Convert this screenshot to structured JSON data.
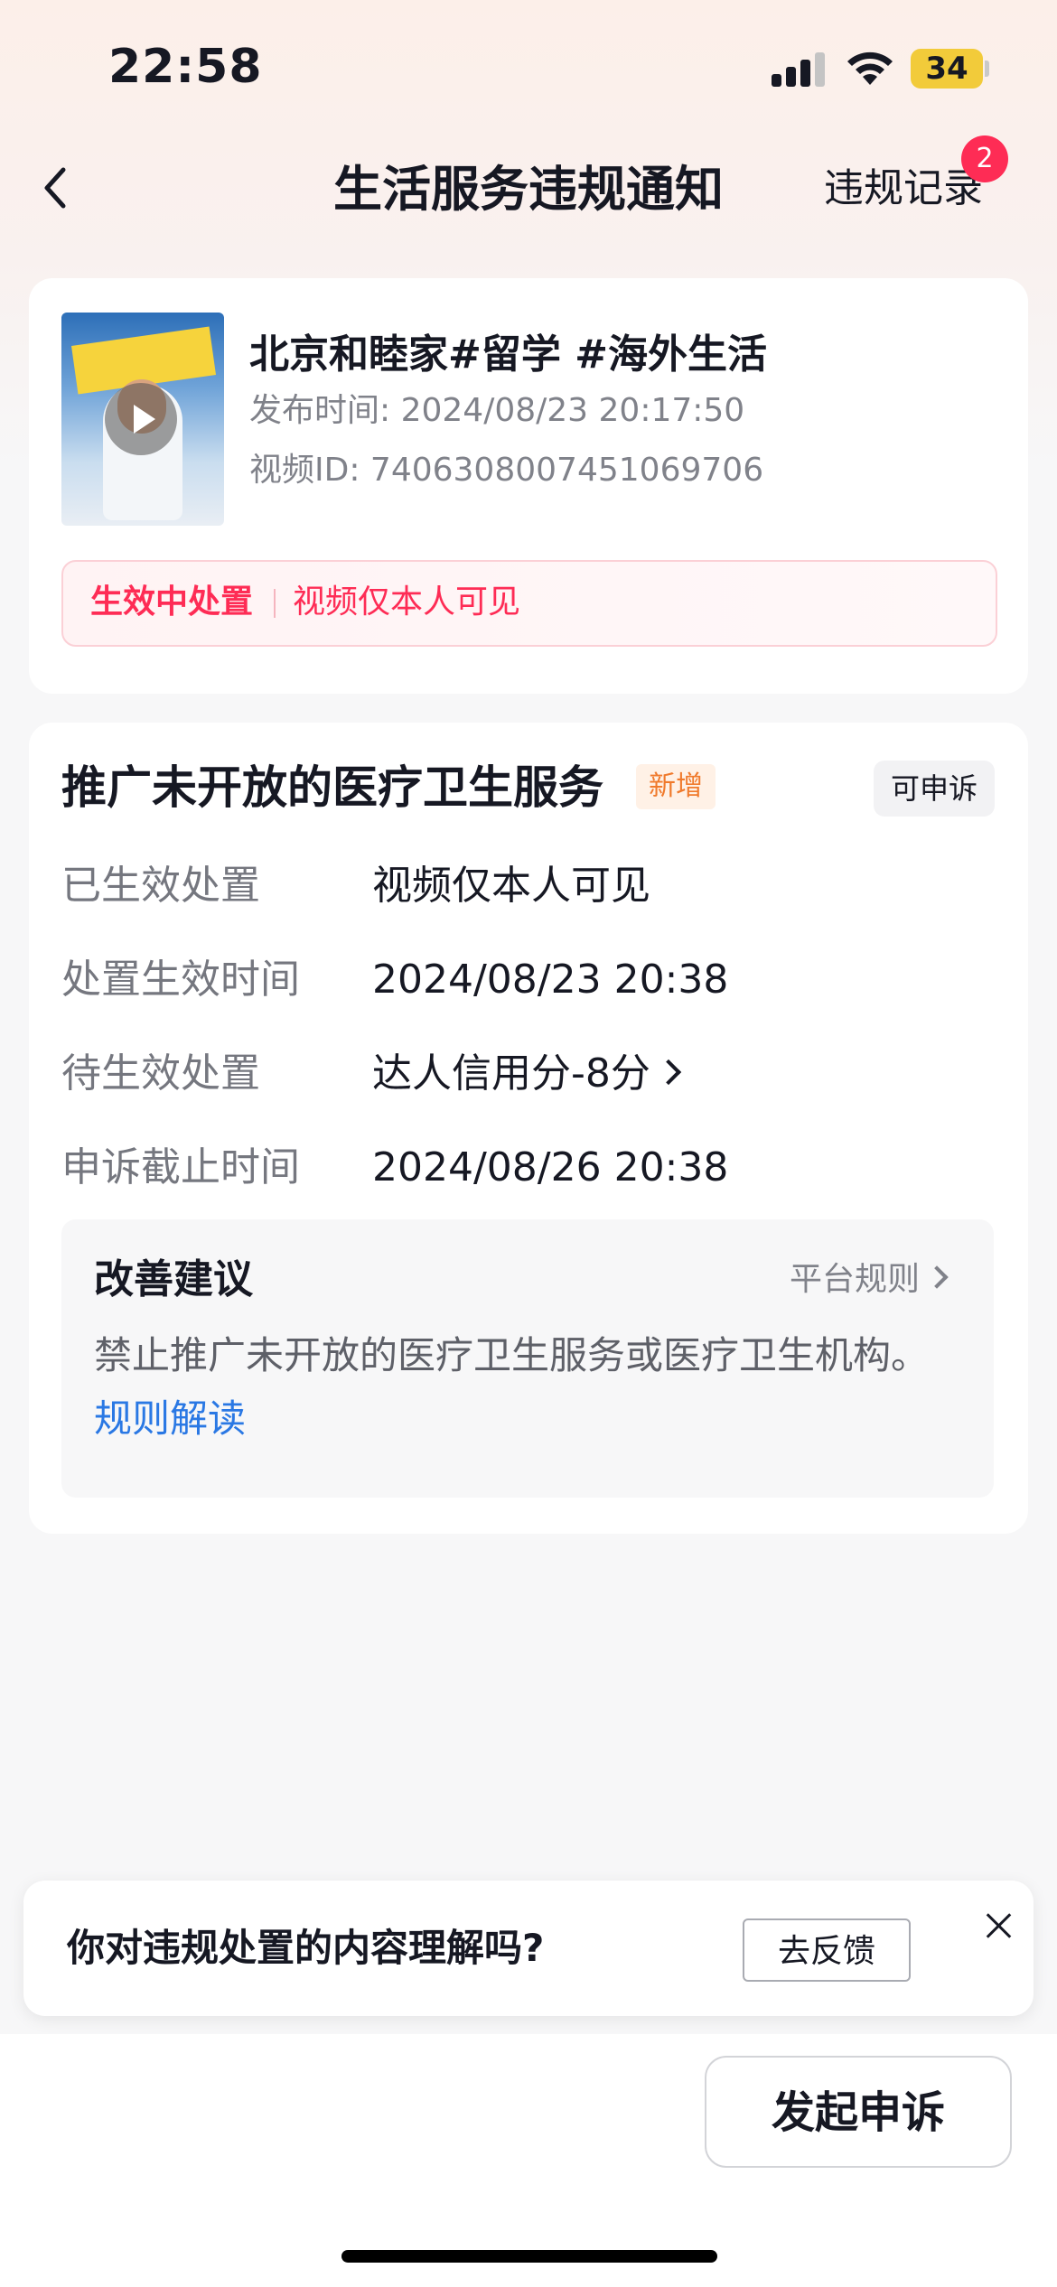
{
  "status_bar": {
    "time": "22:58",
    "battery": "34"
  },
  "nav": {
    "title": "生活服务违规通知",
    "record_label": "违规记录",
    "record_badge": "2"
  },
  "video": {
    "title": "北京和睦家#留学 #海外生活",
    "publish_time": "发布时间: 2024/08/23 20:17:50",
    "video_id": "视频ID: 7406308007451069706",
    "status_label": "生效中处置",
    "status_value": "视频仅本人可见"
  },
  "violation": {
    "title": "推广未开放的医疗卫生服务",
    "new_badge": "新增",
    "appeal_badge": "可申诉",
    "rows": [
      {
        "label": "已生效处置",
        "value": "视频仅本人可见"
      },
      {
        "label": "处置生效时间",
        "value": "2024/08/23 20:38"
      },
      {
        "label": "待生效处置",
        "value": "达人信用分-8分"
      },
      {
        "label": "申诉截止时间",
        "value": "2024/08/26 20:38"
      }
    ],
    "advice": {
      "title": "改善建议",
      "rules_link": "平台规则",
      "text": "禁止推广未开放的医疗卫生服务或医疗卫生机构。",
      "link": "规则解读"
    }
  },
  "feedback": {
    "question": "你对违规处置的内容理解吗?",
    "button": "去反馈"
  },
  "bottom": {
    "appeal_button": "发起申诉"
  },
  "colors": {
    "accent": "#fe2c55",
    "link": "#2a78e4",
    "badge_orange": "#f07a2c"
  }
}
